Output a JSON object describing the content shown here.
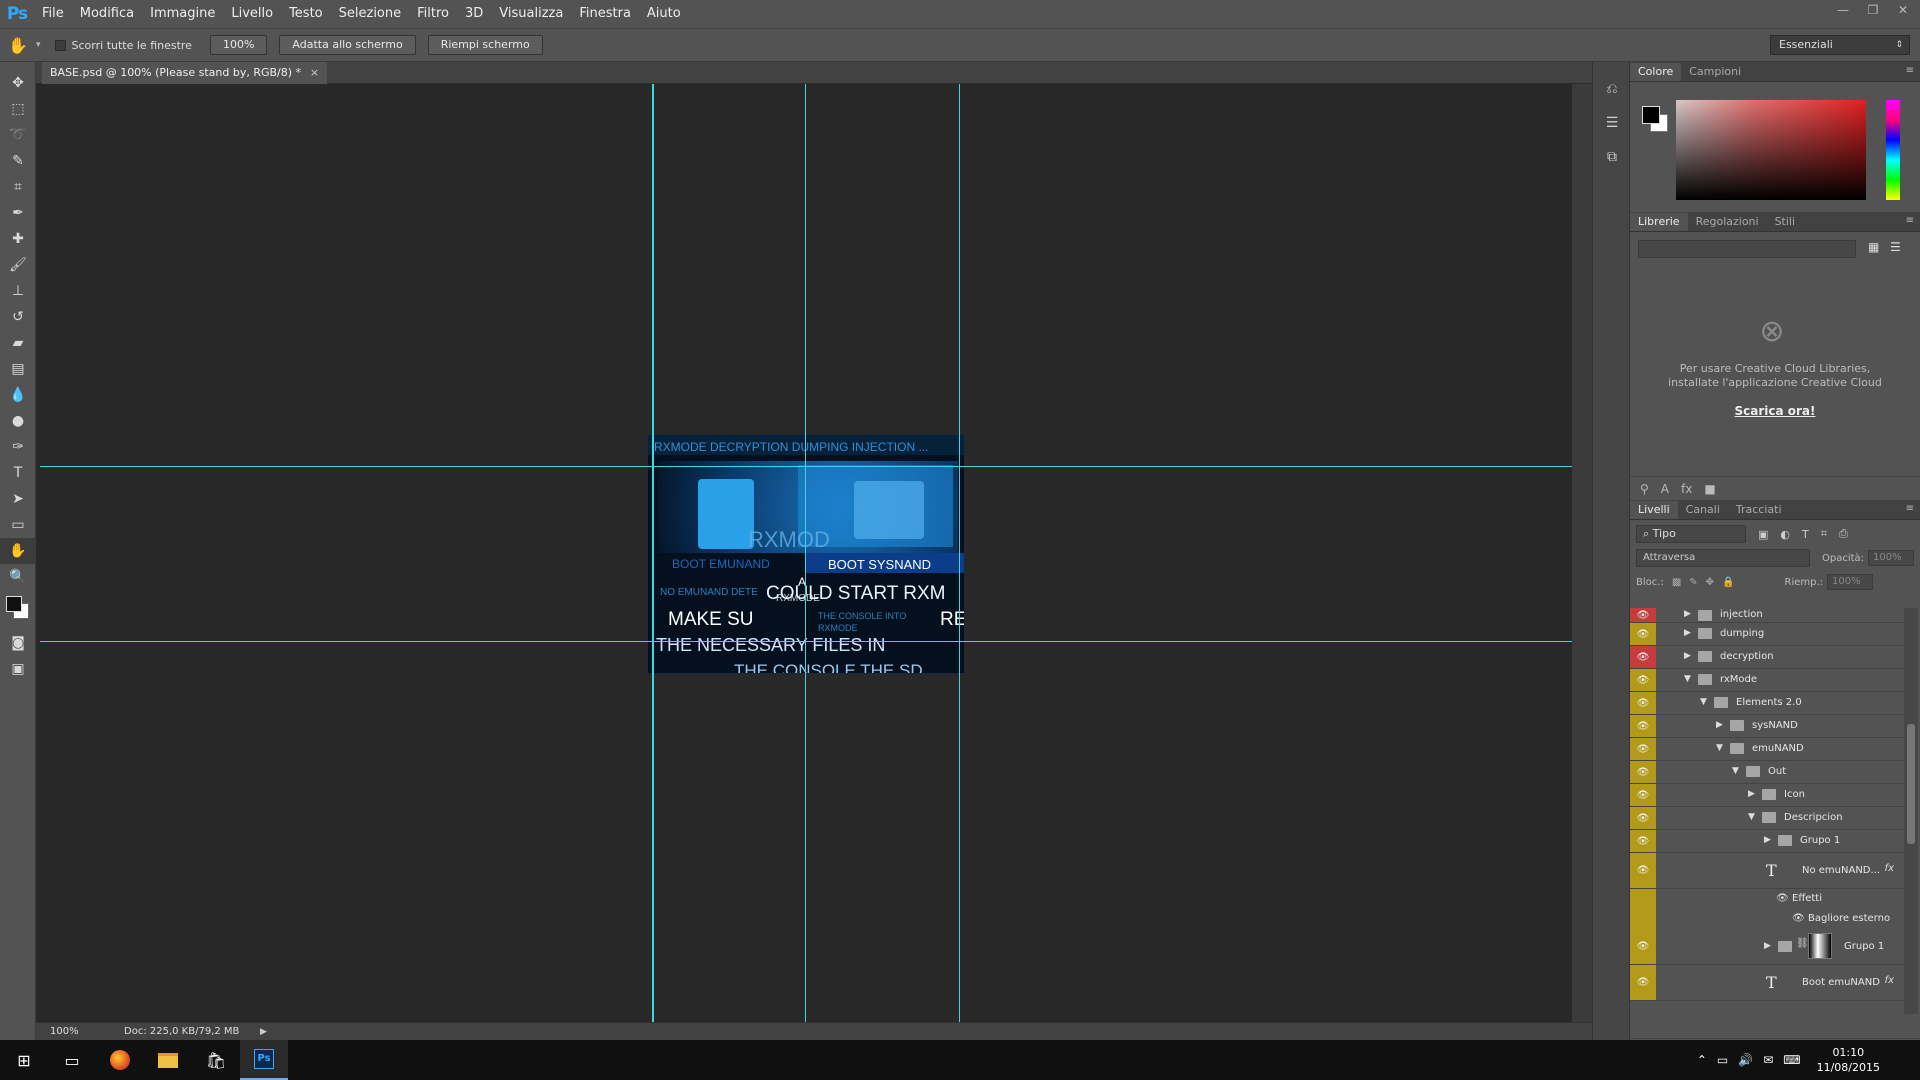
{
  "app": {
    "logo": "Ps"
  },
  "menu": [
    "File",
    "Modifica",
    "Immagine",
    "Livello",
    "Testo",
    "Selezione",
    "Filtro",
    "3D",
    "Visualizza",
    "Finestra",
    "Aiuto"
  ],
  "window_controls": {
    "minimize": "—",
    "restore": "❐",
    "close": "✕"
  },
  "options": {
    "scroll_all_label": "Scorri tutte le finestre",
    "zoom_button": "100%",
    "fit_button": "Adatta allo schermo",
    "fill_button": "Riempi schermo",
    "workspace": "Essenziali"
  },
  "document": {
    "tab_title": "BASE.psd @ 100% (Please stand by, RGB/8) *",
    "close": "×",
    "canvas_text": {
      "top_strip": "RXMODE  DECRYPTION  DUMPING  INJECTION ...",
      "rxmode": "RXMOD",
      "boot_emunand": "BOOT EMUNAND",
      "boot_sysnand": "BOOT SYSNAND",
      "no_emunand": "NO EMUNAND DETE",
      "a": "A",
      "rxmode_small": "RXMODE",
      "could_start": "COULD START RXM",
      "console_into": "THE CONSOLE INTO",
      "rxmode2": "RXMODE",
      "make_sure": "MAKE SU",
      "re": "RE",
      "necessary": "THE NECESSARY FILES IN",
      "console_sd": "THE CONSOLE THE SD"
    }
  },
  "status": {
    "zoom": "100%",
    "doc": "Doc: 225,0 KB/79,2 MB",
    "arrow": "▶"
  },
  "panels": {
    "color_tabs": [
      "Colore",
      "Campioni"
    ],
    "library_tabs": [
      "Librerie",
      "Regolazioni",
      "Stili"
    ],
    "library_msg1": "Per usare Creative Cloud Libraries,",
    "library_msg2": "installate l'applicazione Creative Cloud",
    "library_link": "Scarica ora!",
    "layers_tabs": [
      "Livelli",
      "Canali",
      "Tracciati"
    ],
    "filter_kind": "Tipo",
    "blend_mode": "Attraversa",
    "opacity_label": "Opacità:",
    "opacity_value": "100%",
    "lock_label": "Bloc.:",
    "fill_label": "Riemp.:",
    "fill_value": "100%"
  },
  "layers": [
    {
      "name": "injection",
      "type": "group"
    },
    {
      "name": "dumping",
      "type": "group"
    },
    {
      "name": "decryption",
      "type": "group"
    },
    {
      "name": "rxMode",
      "type": "group"
    },
    {
      "name": "Elements 2.0",
      "type": "group"
    },
    {
      "name": "sysNAND",
      "type": "group"
    },
    {
      "name": "emuNAND",
      "type": "group"
    },
    {
      "name": "Out",
      "type": "group"
    },
    {
      "name": "Icon",
      "type": "group"
    },
    {
      "name": "Descripcion",
      "type": "group"
    },
    {
      "name": "Grupo 1",
      "type": "group"
    },
    {
      "name": "No emuNAND...",
      "type": "text"
    },
    {
      "name": "Effetti",
      "type": "effect"
    },
    {
      "name": "Bagliore esterno",
      "type": "effect"
    },
    {
      "name": "Grupo 1",
      "type": "group-mask"
    },
    {
      "name": "Boot emuNAND",
      "type": "text"
    }
  ],
  "taskbar": {
    "time": "01:10",
    "date": "11/08/2015"
  },
  "colors": {
    "accent_ps": "#31a8ff",
    "guide": "#3fd6e0",
    "layer_visible": "#b39a1a",
    "layer_red": "#c43c3c"
  }
}
